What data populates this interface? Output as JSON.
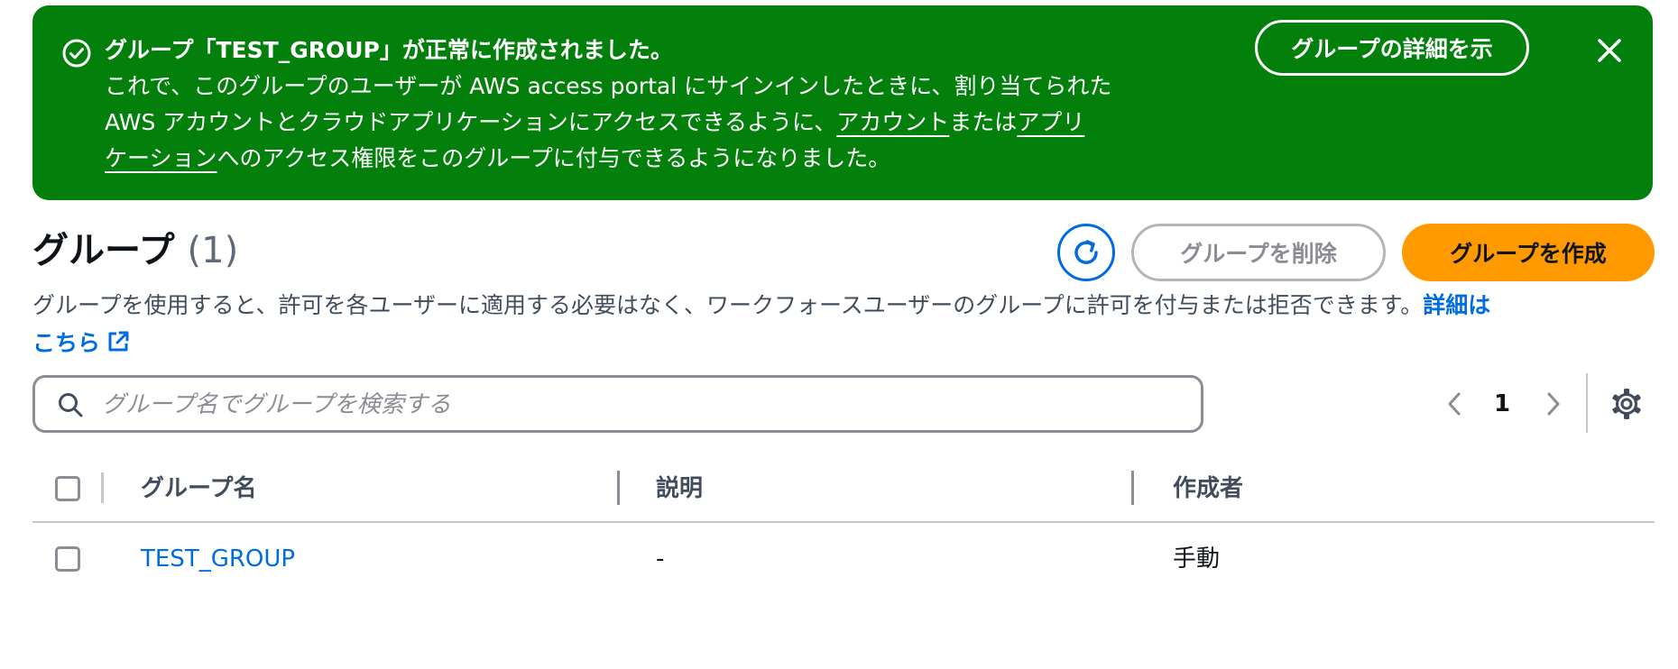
{
  "flash": {
    "type": "success",
    "title": "グループ「TEST_GROUP」が正常に作成されました。",
    "body_line1": "これで、このグループのユーザーが AWS access portal にサインインしたときに、割り当てられた",
    "body_line2_prefix": "AWS アカウントとクラウドアプリケーションにアクセスできるように、",
    "body_link_accounts": "アカウント",
    "body_or": "または",
    "body_link_apps_part1": "アプリ",
    "body_link_apps_part2": "ケーション",
    "body_suffix": "へのアクセス権限をこのグループに付与できるようになりました。",
    "view_details_label": "グループの詳細を示"
  },
  "header": {
    "title": "グループ",
    "count": "(1)",
    "delete_label": "グループを削除",
    "create_label": "グループを作成"
  },
  "description": {
    "text": "グループを使用すると、許可を各ユーザーに適用する必要はなく、ワークフォースユーザーのグループに許可を付与または拒否できます。",
    "learn_more_part1": "詳細は",
    "learn_more_part2": "こちら"
  },
  "search": {
    "placeholder": "グループ名でグループを検索する",
    "value": ""
  },
  "pagination": {
    "current_page": "1"
  },
  "table": {
    "columns": [
      "グループ名",
      "説明",
      "作成者"
    ],
    "rows": [
      {
        "name": "TEST_GROUP",
        "description": "-",
        "created_by": "手動"
      }
    ]
  },
  "colors": {
    "success_bg": "#037f0c",
    "primary_orange": "#ff9900",
    "link_blue": "#006ce0",
    "disabled_gray": "#8c8c94"
  }
}
